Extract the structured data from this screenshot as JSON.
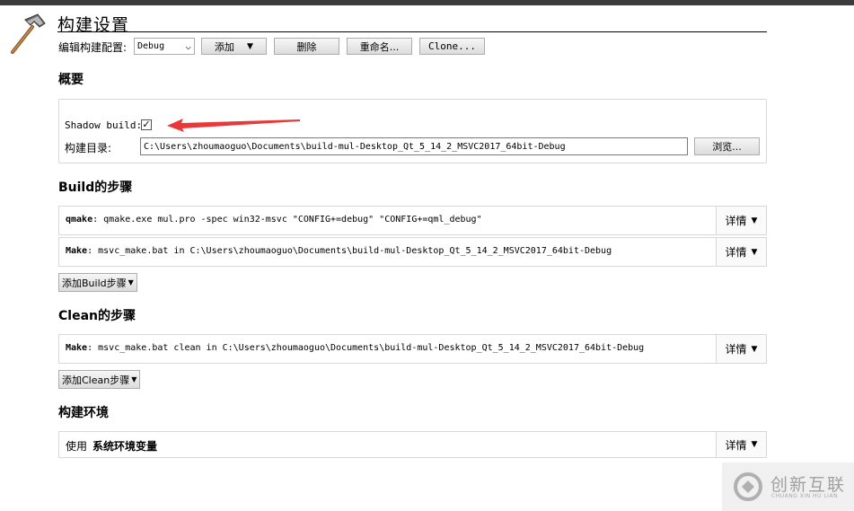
{
  "page": {
    "title": "构建设置"
  },
  "config": {
    "label": "编辑构建配置:",
    "selected": "Debug",
    "add_label": "添加",
    "delete_label": "删除",
    "rename_label": "重命名...",
    "clone_label": "Clone..."
  },
  "overview": {
    "heading": "概要",
    "shadow_build_label": "Shadow build:",
    "shadow_build_checked": true,
    "build_dir_label": "构建目录:",
    "build_dir_value": "C:\\Users\\zhoumaoguo\\Documents\\build-mul-Desktop_Qt_5_14_2_MSVC2017_64bit-Debug",
    "browse_label": "浏览..."
  },
  "build_steps": {
    "heading": "Build的步骤",
    "steps": [
      {
        "name": "qmake",
        "command": ": qmake.exe mul.pro -spec win32-msvc \"CONFIG+=debug\" \"CONFIG+=qml_debug\"",
        "detail_label": "详情"
      },
      {
        "name": "Make",
        "command": ": msvc_make.bat in C:\\Users\\zhoumaoguo\\Documents\\build-mul-Desktop_Qt_5_14_2_MSVC2017_64bit-Debug",
        "detail_label": "详情"
      }
    ],
    "add_label": "添加Build步骤"
  },
  "clean_steps": {
    "heading": "Clean的步骤",
    "steps": [
      {
        "name": "Make",
        "command": ": msvc_make.bat clean in C:\\Users\\zhoumaoguo\\Documents\\build-mul-Desktop_Qt_5_14_2_MSVC2017_64bit-Debug",
        "detail_label": "详情"
      }
    ],
    "add_label": "添加Clean步骤"
  },
  "environment": {
    "heading": "构建环境",
    "use_label": "使用",
    "env_name": "系统环境变量",
    "detail_label": "详情"
  },
  "watermark": {
    "title": "创新互联",
    "subtitle": "CHUANG XIN HU LIAN"
  },
  "icons": {
    "hammer": "hammer-icon",
    "arrow": "red-arrow-annotation",
    "dropdown": "chevron-down-icon"
  },
  "colors": {
    "annotation_arrow": "#e8383a",
    "top_bar": "#3c3c3c"
  }
}
